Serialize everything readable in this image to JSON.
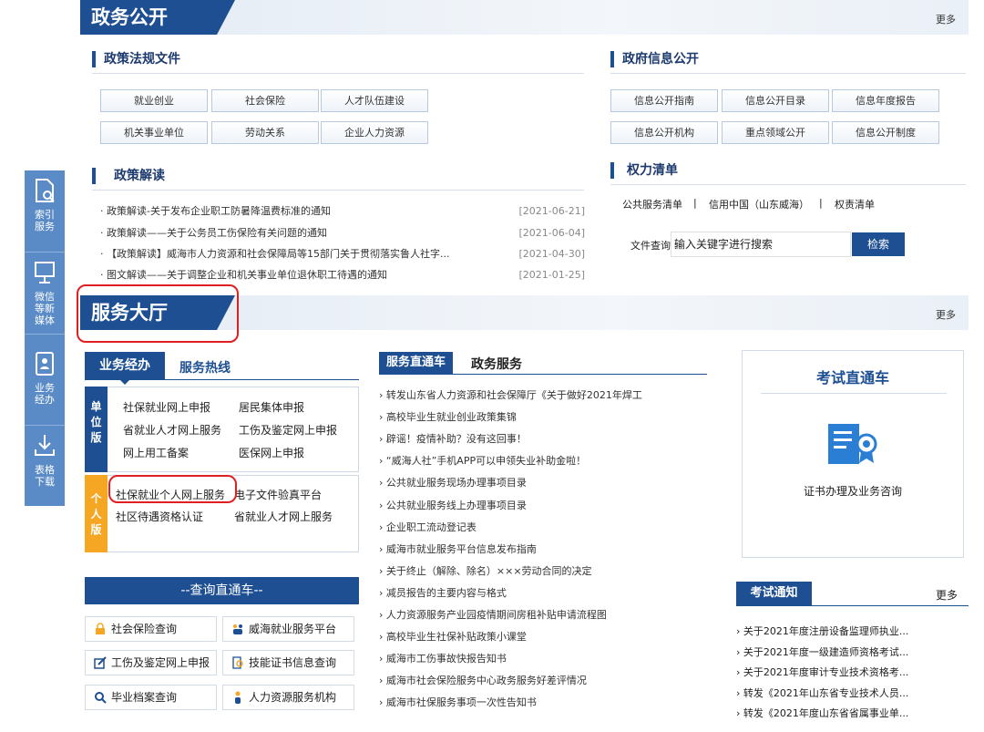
{
  "float_bar": [
    {
      "label_1": "索引",
      "label_2": "服务",
      "icon": "index-search-icon"
    },
    {
      "label_1": "微信",
      "label_2": "等新",
      "label_3": "媒体",
      "icon": "monitor-icon"
    },
    {
      "label_1": "业务",
      "label_2": "经办",
      "icon": "id-card-icon"
    },
    {
      "label_1": "表格",
      "label_2": "下载",
      "icon": "download-icon"
    }
  ],
  "gov_open": {
    "title": "政务公开",
    "more": "更多",
    "policy_files": {
      "title": "政策法规文件",
      "items": [
        "就业创业",
        "社会保险",
        "人才队伍建设",
        "机关事业单位",
        "劳动关系",
        "企业人力资源"
      ]
    },
    "gov_info": {
      "title": "政府信息公开",
      "items": [
        "信息公开指南",
        "信息公开目录",
        "信息年度报告",
        "信息公开机构",
        "重点领域公开",
        "信息公开制度"
      ]
    },
    "policy_read": {
      "title": "政策解读",
      "items": [
        {
          "text": "· 政策解读-关于发布企业职工防暑降温费标准的通知",
          "date": "[2021-06-21]"
        },
        {
          "text": "· 政策解读——关于公务员工伤保险有关问题的通知",
          "date": "[2021-06-04]"
        },
        {
          "text": "· 【政策解读】威海市人力资源和社会保障局等15部门关于贯彻落实鲁人社字...",
          "date": "[2021-04-30]"
        },
        {
          "text": "· 图文解读——关于调整企业和机关事业单位退休职工待遇的通知",
          "date": "[2021-01-25]"
        }
      ]
    },
    "power_list": {
      "title": "权力清单",
      "links": [
        "公共服务清单",
        "|",
        "信用中国（山东威海）",
        "|",
        "权责清单"
      ],
      "search_label": "文件查询 :",
      "search_value": "输入关键字进行搜索",
      "search_button": "检索"
    }
  },
  "service_hall": {
    "title": "服务大厅",
    "more": "更多",
    "tab_active": "业务经办",
    "tab_other": "服务热线",
    "unit_side": "单位版",
    "unit_links": [
      "社保就业网上申报",
      "居民集体申报",
      "省就业人才网上服务",
      "工伤及鉴定网上申报",
      "网上用工备案",
      "医保网上申报"
    ],
    "personal_side": "个人版",
    "personal_links": [
      "社保就业个人网上服务",
      "电子文件验真平台",
      "社区待遇资格认证",
      "省就业人才网上服务"
    ],
    "query_title": "--查询直通车--",
    "query_buttons": [
      "社会保险查询",
      "威海就业服务平台",
      "工伤及鉴定网上申报",
      "技能证书信息查询",
      "毕业档案查询",
      "人力资源服务机构"
    ],
    "mid_tab_active": "服务直通车",
    "mid_tab_other": "政务服务",
    "mid_list": [
      "› 转发山东省人力资源和社会保障厅《关于做好2021年焊工",
      "› 高校毕业生就业创业政策集锦",
      "› 辟谣！疫情补助？没有这回事！",
      "› “威海人社”手机APP可以申领失业补助金啦！",
      "› 公共就业服务现场办理事项目录",
      "› 公共就业服务线上办理事项目录",
      "› 企业职工流动登记表",
      "› 威海市就业服务平台信息发布指南",
      "› 关于终止（解除、除名）×××劳动合同的决定",
      "› 减员报告的主要内容与格式",
      "› 人力资源服务产业园疫情期间房租补贴申请流程图",
      "› 高校毕业生社保补贴政策小课堂",
      "› 威海市工伤事故快报告知书",
      "› 威海市社会保险服务中心政务服务好差评情况",
      "› 威海市社保服务事项一次性告知书"
    ],
    "exam": {
      "title": "考试直通车",
      "caption": "证书办理及业务咨询"
    },
    "notice": {
      "title": "考试通知",
      "more": "更多",
      "items": [
        "› 关于2021年度注册设备监理师执业...",
        "› 关于2021年度一级建造师资格考试...",
        "› 关于2021年度审计专业技术资格考...",
        "› 转发《2021年山东省专业技术人员...",
        "› 转发《2021年度山东省省属事业单..."
      ]
    }
  },
  "colors": {
    "primary": "#1d4f92",
    "accent": "#f5a623",
    "highlight": "#e02020"
  }
}
